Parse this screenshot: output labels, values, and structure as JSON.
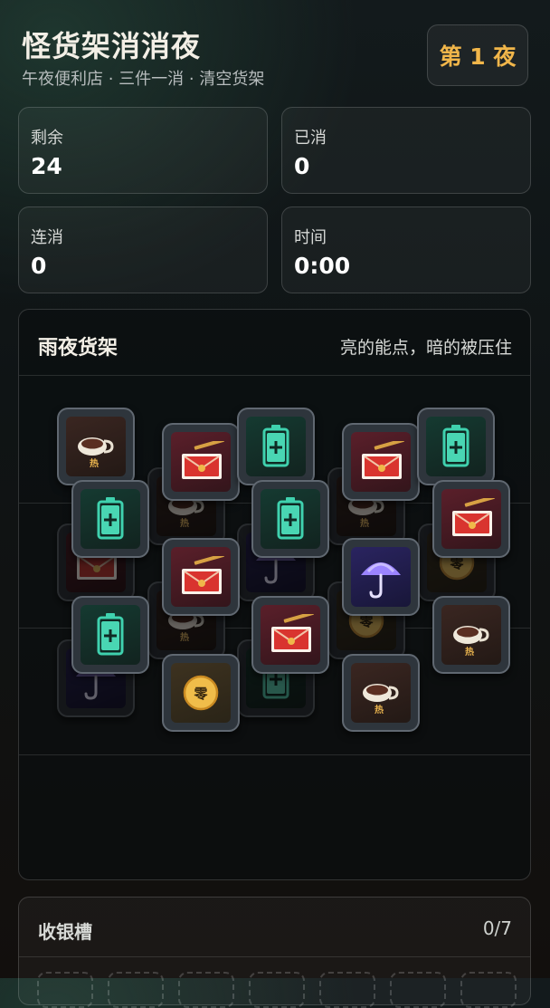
{
  "header": {
    "title": "怪货架消消夜",
    "subtitle": "午夜便利店 · 三件一消 · 清空货架",
    "night_badge": "第 1 夜"
  },
  "stats": {
    "remaining": {
      "label": "剩余",
      "value": "24"
    },
    "cleared": {
      "label": "已消",
      "value": "0"
    },
    "combo": {
      "label": "连消",
      "value": "0"
    },
    "time": {
      "label": "时间",
      "value": "0:00"
    }
  },
  "board": {
    "title": "雨夜货架",
    "hint": "亮的能点，暗的被压住",
    "glyphs": {
      "hot": "热",
      "coin": "零"
    },
    "tiles": [
      {
        "item": "coffee",
        "state": "available"
      },
      {
        "item": "envelope",
        "state": "available"
      },
      {
        "item": "battery",
        "state": "available"
      },
      {
        "item": "envelope",
        "state": "available"
      },
      {
        "item": "battery",
        "state": "available"
      },
      {
        "item": "battery",
        "state": "available"
      },
      {
        "item": "battery",
        "state": "available"
      },
      {
        "item": "envelope",
        "state": "available"
      },
      {
        "item": "envelope",
        "state": "available"
      },
      {
        "item": "umbrella",
        "state": "available"
      },
      {
        "item": "battery",
        "state": "available"
      },
      {
        "item": "envelope",
        "state": "available"
      },
      {
        "item": "coffee",
        "state": "available"
      },
      {
        "item": "coin",
        "state": "available"
      },
      {
        "item": "coffee",
        "state": "available"
      },
      {
        "item": "coffee",
        "state": "covered"
      },
      {
        "item": "envelope",
        "state": "covered"
      },
      {
        "item": "umbrella",
        "state": "covered"
      },
      {
        "item": "umbrella",
        "state": "covered"
      },
      {
        "item": "coffee",
        "state": "covered"
      },
      {
        "item": "coffee",
        "state": "covered"
      },
      {
        "item": "coin",
        "state": "covered"
      },
      {
        "item": "coin",
        "state": "covered"
      },
      {
        "item": "battery",
        "state": "covered"
      }
    ]
  },
  "tray": {
    "title": "收银槽",
    "count": "0/7"
  },
  "colors": {
    "accent": "#f1b64a",
    "coffee_bg": "#3a2621",
    "envelope_bg": "#5a1f2a",
    "battery_bg": "#153a31",
    "umbrella_bg": "#2a2460",
    "coin_bg": "#3d3220"
  }
}
